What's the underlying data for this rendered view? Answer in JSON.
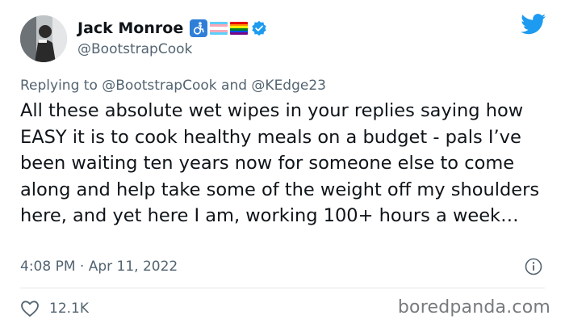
{
  "author": {
    "display_name": "Jack Monroe",
    "handle": "@BootstrapCook",
    "name_emojis": [
      "accessibility-icon",
      "transgender-flag",
      "rainbow-flag"
    ],
    "verified": true
  },
  "reply": {
    "prefix": "Replying to ",
    "mention1": "@BootstrapCook",
    "joiner": " and ",
    "mention2": "@KEdge23"
  },
  "tweet": {
    "text": "All these absolute wet wipes in your replies saying how EASY it is to cook healthy meals on a budget - pals I’ve been waiting ten years now for someone else to come along and help take some of the weight off my shoulders here, and yet here I am, working 100+ hours a week…",
    "timestamp": "4:08 PM · Apr 11, 2022"
  },
  "engagement": {
    "likes": "12.1K"
  },
  "watermark": "boredpanda.com",
  "colors": {
    "twitter_blue": "#1d9bf0",
    "text_primary": "#0f1419",
    "text_secondary": "#536471"
  }
}
